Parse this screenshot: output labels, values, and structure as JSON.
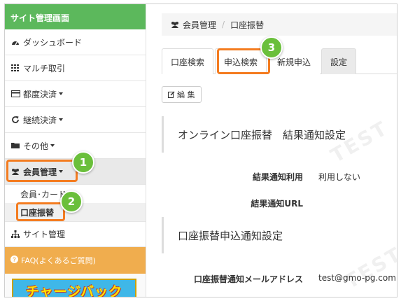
{
  "sidebar": {
    "header": "サイト管理画面",
    "items": [
      {
        "label": "ダッシュボード",
        "icon": "dashboard-icon"
      },
      {
        "label": "マルチ取引",
        "icon": "grid-icon"
      },
      {
        "label": "都度決済",
        "icon": "credit-card-icon"
      },
      {
        "label": "継続決済",
        "icon": "refresh-icon"
      },
      {
        "label": "その他",
        "icon": "folder-icon"
      },
      {
        "label": "会員管理",
        "icon": "users-icon"
      }
    ],
    "sub_items": [
      {
        "label": "会員･カード"
      },
      {
        "label": "口座振替"
      }
    ],
    "site_admin": "サイト管理",
    "faq": "FAQ(よくあるご質問)",
    "banner": "チャージバック"
  },
  "breadcrumb": {
    "parent": "会員管理",
    "current": "口座振替"
  },
  "tabs": [
    "口座検索",
    "申込検索",
    "新規申込",
    "設定"
  ],
  "edit_button": "編 集",
  "sections": [
    {
      "title": "オンライン口座振替　結果通知設定",
      "rows": [
        {
          "label": "結果通知利用",
          "value": "利用しない"
        },
        {
          "label": "結果通知URL",
          "value": ""
        }
      ]
    },
    {
      "title": "口座振替申込通知設定",
      "rows": [
        {
          "label": "口座振替通知メールアドレス",
          "value": "test@gmo-pg.com"
        }
      ]
    }
  ],
  "badges": [
    "1",
    "2",
    "3"
  ],
  "watermark": "TEST",
  "colors": {
    "header_green": "#5cb85c",
    "faq_orange": "#f0ad4e",
    "highlight": "#f47c20",
    "badge_green": "#6abf3b"
  }
}
